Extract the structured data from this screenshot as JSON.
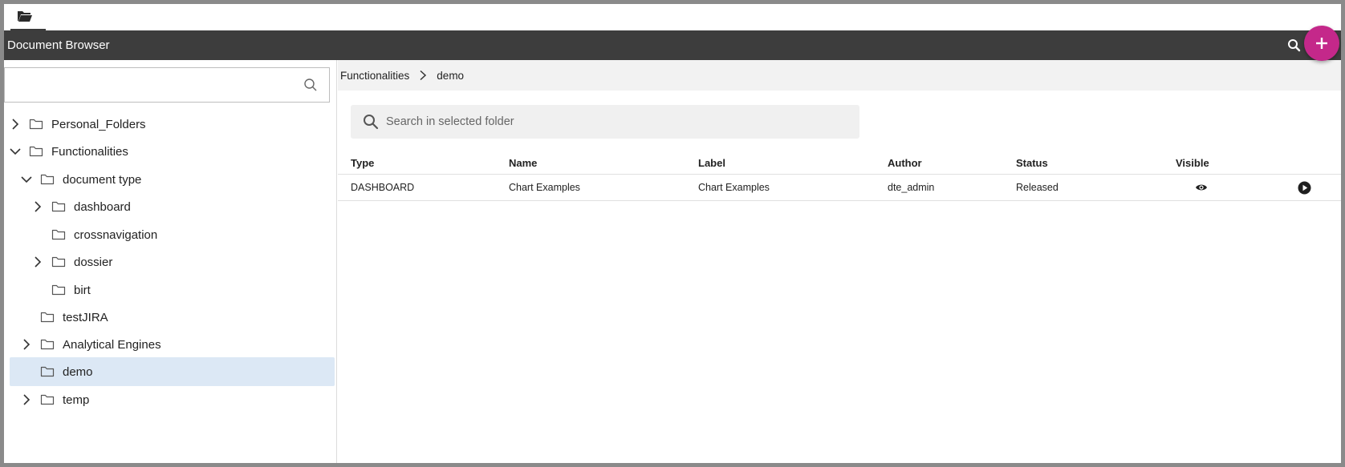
{
  "header": {
    "title": "Document Browser",
    "search_icon": "search-icon",
    "add_icon": "plus-icon",
    "accent_color": "#c4288a"
  },
  "tabstrip": {
    "active_icon": "folder-open-icon"
  },
  "sidebar": {
    "search_placeholder": "",
    "tree": [
      {
        "label": "Personal_Folders",
        "expandable": true,
        "expanded": false
      },
      {
        "label": "Functionalities",
        "expandable": true,
        "expanded": true
      },
      {
        "label": "document type",
        "expandable": true,
        "expanded": true
      },
      {
        "label": "dashboard",
        "expandable": true,
        "expanded": false
      },
      {
        "label": "crossnavigation",
        "expandable": false
      },
      {
        "label": "dossier",
        "expandable": true,
        "expanded": false
      },
      {
        "label": "birt",
        "expandable": false
      },
      {
        "label": "testJIRA",
        "expandable": false
      },
      {
        "label": "Analytical Engines",
        "expandable": true,
        "expanded": false
      },
      {
        "label": "demo",
        "expandable": false,
        "selected": true
      },
      {
        "label": "temp",
        "expandable": true,
        "expanded": false
      }
    ]
  },
  "main": {
    "breadcrumb": [
      "Functionalities",
      "demo"
    ],
    "search_placeholder": "Search in selected folder",
    "columns": [
      "Type",
      "Name",
      "Label",
      "Author",
      "Status",
      "Visible"
    ],
    "rows": [
      {
        "type": "DASHBOARD",
        "name": "Chart Examples",
        "label": "Chart Examples",
        "author": "dte_admin",
        "status": "Released",
        "visible_icon": "eye-icon",
        "action_icon": "play-circle-icon"
      }
    ]
  }
}
